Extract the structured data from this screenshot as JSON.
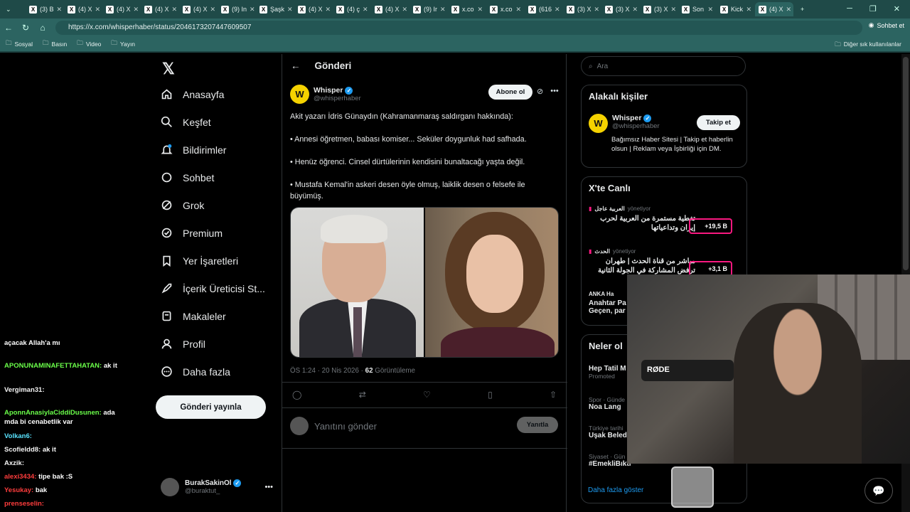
{
  "browser": {
    "tabs": [
      "(3) B",
      "(4) X",
      "(4) X",
      "(4) X",
      "(4) X",
      "(9) In",
      "Şaşk",
      "(4) X",
      "(4) ç",
      "(4) X",
      "(9) Ir",
      "x.co",
      "x.co",
      "(616",
      "(3) X",
      "(3) X",
      "(3) X",
      "Son",
      "Kick",
      "(4) X"
    ],
    "url": "https://x.com/whisperhaber/status/2046173207447609507",
    "chat_label": "Sohbet et",
    "bookmarks": [
      "Sosyal",
      "Basın",
      "Video",
      "Yayın"
    ],
    "other_bookmarks": "Diğer sık kullanılanlar"
  },
  "nav": {
    "items": [
      "Anasayfa",
      "Keşfet",
      "Bildirimler",
      "Sohbet",
      "Grok",
      "Premium",
      "Yer İşaretleri",
      "İçerik Üreticisi St...",
      "Makaleler",
      "Profil",
      "Daha fazla"
    ],
    "post_button": "Gönderi yayınla",
    "account": {
      "name": "BurakSakinOl",
      "handle": "@buraktut_"
    }
  },
  "main": {
    "title": "Gönderi",
    "author": {
      "name": "Whisper",
      "handle": "@whisperhaber"
    },
    "subscribe_label": "Abone ol",
    "paragraphs": [
      "Akit yazarı İdris Günaydın (Kahramanmaraş saldırganı hakkında):",
      "• Annesi öğretmen, babası komiser... Seküler doygunluk had safhada.",
      "• Henüz öğrenci. Cinsel dürtülerinin kendisini bunaltacağı yaşta değil.",
      "• Mustafa Kemal'in askeri desen öyle olmuş, laiklik desen o felsefe ile büyümüş."
    ],
    "timestamp": "ÖS 1:24 · 20 Nis 2026 ·",
    "views_count": "62",
    "views_label": "Görüntüleme",
    "reply_placeholder": "Yanıtını gönder",
    "reply_button": "Yanıtla"
  },
  "sidebar": {
    "search_placeholder": "Ara",
    "related_title": "Alakalı kişiler",
    "related": {
      "name": "Whisper",
      "handle": "@whisperhaber",
      "bio": "Bağımsız Haber Sitesi | Takip et haberlin olsun | Reklam veya İşbirliği için DM.",
      "follow_label": "Takip et"
    },
    "live_title": "X'te Canlı",
    "live": [
      {
        "channel": "العربية عاجل",
        "status": "yönetiyor",
        "title": "تغطية مستمرة من العربية لحرب إيران وتداعياتها",
        "count": "+19,5 B"
      },
      {
        "channel": "الحدث",
        "status": "yönetiyor",
        "title": "مباشر من قناة الحدث | طهران ترفض المشاركة في الجولة الثانية من ...",
        "count": "+3,1 B"
      },
      {
        "channel": "ANKA Ha",
        "title": "Anahtar Pa",
        "subtitle": "Geçen, par"
      }
    ],
    "trends_title": "Neler ol",
    "trends": [
      {
        "context": "Hep Tatil M",
        "title": "",
        "extra": "Promoted"
      },
      {
        "context": "Spor · Günde",
        "title": "Noa Lang"
      },
      {
        "context": "Türkiye tarihi",
        "title": "Uşak Beled"
      },
      {
        "context": "Siyaset · Gün",
        "title": "#EmekliBıktı"
      }
    ],
    "more_label": "Daha fazla göster"
  },
  "stream_chat": [
    {
      "user": "",
      "text": "açacak Allah'a mı"
    },
    {
      "user": "APONUNAMINAFETTAHATAN:",
      "text": "ak it"
    },
    {
      "user": "Vergiman31:",
      "text": ""
    },
    {
      "user": "AponnAnasiylaCiddiDusunen:",
      "text": "ada mda bi cenabetlik var"
    },
    {
      "user": "Volkan6:",
      "text": ""
    },
    {
      "user": "Scofieldd8:",
      "text": "ak it"
    },
    {
      "user": "Axzik:",
      "text": ""
    },
    {
      "user": "alexi3434:",
      "text": "tipe bak :S"
    },
    {
      "user": "Yesukay:",
      "text": "bak"
    },
    {
      "user": "prenseselin:",
      "text": ""
    }
  ],
  "webcam": {
    "mic_label": "RØDE"
  }
}
